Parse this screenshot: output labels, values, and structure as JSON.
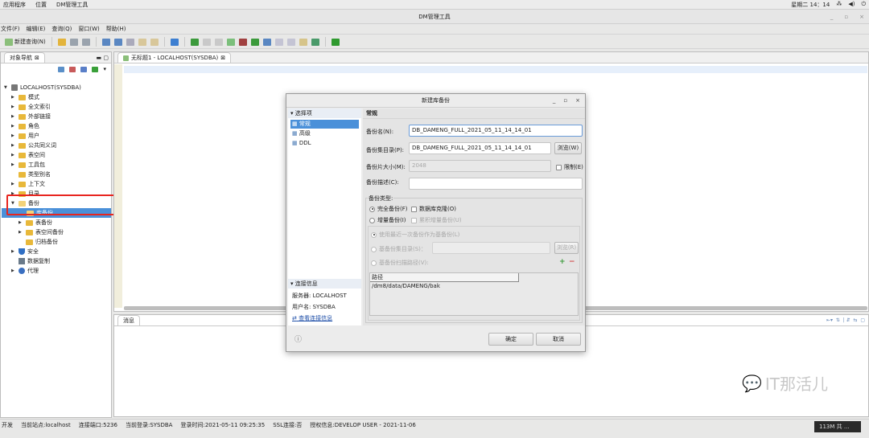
{
  "topbar": {
    "apps": "应用程序",
    "places": "位置",
    "tool": "DM管理工具",
    "clock": "星期二 14：14"
  },
  "window": {
    "title": "DM管理工具"
  },
  "menu": [
    "文件(F)",
    "编辑(E)",
    "查询(Q)",
    "窗口(W)",
    "帮助(H)"
  ],
  "toolbar": {
    "new_query": "新建查询(N)"
  },
  "nav": {
    "tab": "对象导航",
    "root": "LOCALHOST(SYSDBA)",
    "items": [
      {
        "label": "模式",
        "exp": true
      },
      {
        "label": "全文索引",
        "exp": true
      },
      {
        "label": "外部链接",
        "exp": true
      },
      {
        "label": "角色",
        "exp": true
      },
      {
        "label": "用户",
        "exp": true
      },
      {
        "label": "公共同义词",
        "exp": true
      },
      {
        "label": "表空间",
        "exp": true
      },
      {
        "label": "工具包",
        "exp": true
      },
      {
        "label": "类型别名",
        "exp": false
      },
      {
        "label": "上下文",
        "exp": true
      },
      {
        "label": "目录",
        "exp": true
      },
      {
        "label": "备份",
        "exp": true
      }
    ],
    "backup_children": [
      {
        "label": "库备份",
        "exp": false
      },
      {
        "label": "表备份",
        "exp": true
      },
      {
        "label": "表空间备份",
        "exp": true
      },
      {
        "label": "归档备份",
        "exp": false
      }
    ],
    "tail": [
      {
        "label": "安全",
        "exp": true
      },
      {
        "label": "数据复制",
        "exp": false
      },
      {
        "label": "代理",
        "exp": true
      }
    ]
  },
  "editor": {
    "tab": "无标题1 - LOCALHOST(SYSDBA)"
  },
  "messages": {
    "tab": "消息"
  },
  "dialog": {
    "title": "新建库备份",
    "options_header": "选择项",
    "options": [
      "常规",
      "高级",
      "DDL"
    ],
    "conn_header": "连接信息",
    "server": "服务器: LOCALHOST",
    "user": "用户名: SYSDBA",
    "view_conn": "查看连接信息",
    "section": "常规",
    "backup_name_label": "备份名(N):",
    "backup_name": "DB_DAMENG_FULL_2021_05_11_14_14_01",
    "backup_dir_label": "备份集目录(P):",
    "backup_dir": "DB_DAMENG_FULL_2021_05_11_14_14_01",
    "browse_w": "浏览(W)",
    "piece_label": "备份片大小(M):",
    "piece_value": "2048",
    "limit": "限制(E)",
    "desc_label": "备份描述(C):",
    "desc_value": "",
    "type_label": "备份类型:",
    "full": "完全备份(F)",
    "clone": "数据库克隆(O)",
    "incr": "增量备份(I)",
    "cumulative": "累积增量备份(U)",
    "use_recent": "使用最近一次备份作为基备份(L)",
    "base_dir": "基备份集目录(S)：",
    "browse_r": "浏览(R)",
    "base_scan": "基备份扫描路径(V):",
    "path_header": "路径",
    "path_value": "/dm8/data/DAMENG/bak",
    "ok": "确定",
    "cancel": "取消"
  },
  "status": {
    "mode": "开发",
    "site": "当前站点:localhost",
    "port": "连接端口:5236",
    "login": "当前登录:SYSDBA",
    "time": "登录时间:2021-05-11  09:25:35",
    "ssl": "SSL连接:否",
    "license": "授权信息:DEVELOP USER - 2021-11-06",
    "memory": "113M 共 ..."
  },
  "watermark": "IT那活儿"
}
